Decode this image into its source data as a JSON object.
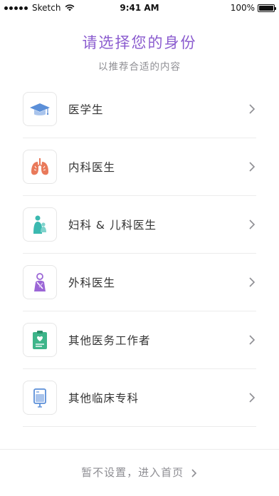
{
  "status_bar": {
    "carrier": "Sketch",
    "time": "9:41 AM",
    "battery": "100%",
    "battery_level": 1.0
  },
  "header": {
    "title": "请选择您的身份",
    "subtitle": "以推荐合适的内容"
  },
  "identities": [
    {
      "label": "医学生",
      "icon": "graduation-cap-icon",
      "color": "#5b8fd8"
    },
    {
      "label": "内科医生",
      "icon": "lungs-icon",
      "color": "#e9795a"
    },
    {
      "label": "妇科 & 儿科医生",
      "icon": "mother-child-icon",
      "color": "#3bb9b0"
    },
    {
      "label": "外科医生",
      "icon": "surgeon-icon",
      "color": "#9b66d6"
    },
    {
      "label": "其他医务工作者",
      "icon": "medical-clipboard-icon",
      "color": "#3eb58a"
    },
    {
      "label": "其他临床专科",
      "icon": "iv-bag-icon",
      "color": "#5b8fd8"
    }
  ],
  "footer": {
    "skip_label": "暂不设置，进入首页"
  },
  "colors": {
    "accent": "#8b5ccf",
    "secondary_text": "#8e8e93",
    "divider": "#ececec"
  }
}
